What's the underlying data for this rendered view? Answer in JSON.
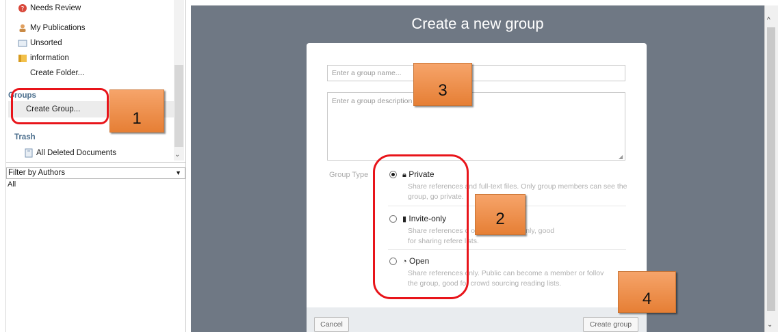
{
  "sidebar": {
    "items": [
      {
        "label": "Needs Review",
        "icon": "warning-icon"
      },
      {
        "label": "My Publications",
        "icon": "user-icon"
      },
      {
        "label": "Unsorted",
        "icon": "document-icon"
      },
      {
        "label": "information",
        "icon": "folder-icon"
      },
      {
        "label": "Create Folder..."
      }
    ],
    "groups_heading": "Groups",
    "create_group": "Create Group...",
    "trash_heading": "Trash",
    "deleted_docs": "All Deleted Documents",
    "filter_label": "Filter by Authors",
    "filter_value": "All"
  },
  "dialog": {
    "title": "Create a new group",
    "name_placeholder": "Enter a group name...",
    "desc_placeholder": "Enter a group description",
    "group_type_label": "Group Type",
    "options": [
      {
        "title": "Private",
        "icon": "lock-icon",
        "desc": "Share references and full-text files. Only group members can see the group, go",
        "desc2": "private.",
        "selected": true
      },
      {
        "title": "Invite-only",
        "icon": "lock-small-icon",
        "desc": "Share references o",
        "desc2": "ollow the group only, good",
        "desc3": "for sharing refere",
        "desc4": "lists.",
        "selected": false
      },
      {
        "title": "Open",
        "icon": "globe-icon",
        "desc": "Share references",
        "desc2": "only. Public can become a member or follov",
        "desc3": "the group, good f",
        "desc4": "or crowd sourcing reading lists.",
        "selected": false
      }
    ],
    "cancel": "Cancel",
    "create": "Create group"
  },
  "annotations": [
    "1",
    "2",
    "3",
    "4"
  ],
  "colors": {
    "accent_red": "#e8141a",
    "callout": "#f0914d",
    "backdrop": "#6f7884"
  }
}
